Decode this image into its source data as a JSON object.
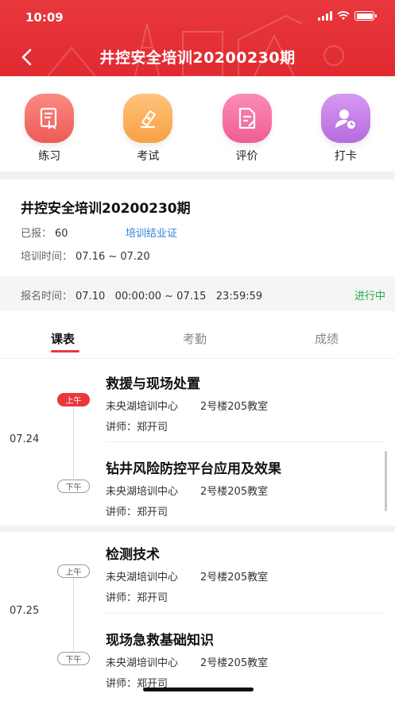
{
  "status_bar": {
    "time": "10:09"
  },
  "header": {
    "title": "井控安全培训20200230期"
  },
  "features": [
    {
      "label": "练习",
      "icon": "practice-icon"
    },
    {
      "label": "考试",
      "icon": "exam-pen-icon"
    },
    {
      "label": "评价",
      "icon": "review-doc-icon"
    },
    {
      "label": "打卡",
      "icon": "checkin-user-clock-icon"
    }
  ],
  "course": {
    "title": "井控安全培训20200230期",
    "enrolled_label": "已报：",
    "enrolled_value": "60",
    "certificate_link": "培训结业证",
    "training_time_label": "培训时间：",
    "training_time_value": "07.16 ~ 07.20",
    "registration_label": "报名时间：",
    "registration_value": "07.10   00:00:00 ~ 07.15   23:59:59",
    "status": "进行中"
  },
  "tabs": [
    {
      "label": "课表",
      "active": true
    },
    {
      "label": "考勤",
      "active": false
    },
    {
      "label": "成绩",
      "active": false
    }
  ],
  "schedule": [
    {
      "date": "07.24",
      "sessions": [
        {
          "period": "上午",
          "title": "救援与现场处置",
          "location": "未央湖培训中心",
          "room": "2号楼205教室",
          "teacher": "讲师：郑开司"
        },
        {
          "period": "下午",
          "title": "钻井风险防控平台应用及效果",
          "location": "未央湖培训中心",
          "room": "2号楼205教室",
          "teacher": "讲师：郑开司"
        }
      ]
    },
    {
      "date": "07.25",
      "sessions": [
        {
          "period": "上午",
          "title": "检测技术",
          "location": "未央湖培训中心",
          "room": "2号楼205教室",
          "teacher": "讲师：郑开司"
        },
        {
          "period": "下午",
          "title": "现场急救基础知识",
          "location": "未央湖培训中心",
          "room": "2号楼205教室",
          "teacher": "讲师：郑开司"
        }
      ]
    }
  ],
  "colors": {
    "brand_red": "#e8383d",
    "status_green": "#1faa4b",
    "link_blue": "#2f7fd8"
  }
}
